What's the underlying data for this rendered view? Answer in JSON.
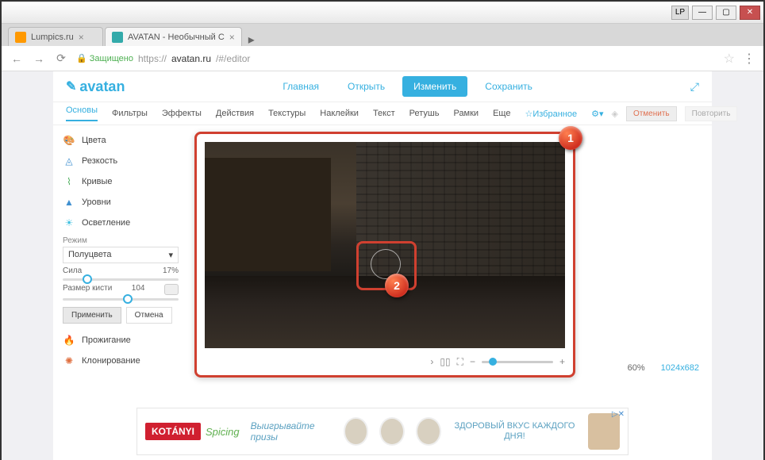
{
  "window": {
    "user_badge": "LP"
  },
  "tabs": [
    {
      "title": "Lumpics.ru"
    },
    {
      "title": "AVATAN - Необычный С"
    }
  ],
  "address": {
    "secure_label": "Защищено",
    "url_prefix": "https://",
    "url_host": "avatan.ru",
    "url_path": "/#/editor"
  },
  "app": {
    "logo": "avatan",
    "nav": {
      "home": "Главная",
      "open": "Открыть",
      "edit": "Изменить",
      "save": "Сохранить"
    },
    "toolbar": {
      "basics": "Основы",
      "filters": "Фильтры",
      "effects": "Эффекты",
      "actions": "Действия",
      "textures": "Текстуры",
      "stickers": "Наклейки",
      "text": "Текст",
      "retouch": "Ретушь",
      "frames": "Рамки",
      "more": "Еще",
      "favorites": "Избранное",
      "undo": "Отменить",
      "redo": "Повторить"
    }
  },
  "sidebar": {
    "colors": "Цвета",
    "sharpness": "Резкость",
    "curves": "Кривые",
    "levels": "Уровни",
    "lighten": "Осветление",
    "mode_label": "Режим",
    "mode_value": "Полуцвета",
    "strength_label": "Сила",
    "strength_value": "17%",
    "brush_label": "Размер кисти",
    "brush_value": "104",
    "apply": "Применить",
    "cancel": "Отмена",
    "burn": "Прожигание",
    "clone": "Клонирование"
  },
  "canvas": {
    "callout1": "1",
    "callout2": "2",
    "zoom_pct": "60%",
    "dimensions": "1024x682",
    "icons": {
      "prev": "›",
      "compare": "▯▯",
      "fullscreen": "⛶",
      "minus": "−",
      "plus": "+"
    }
  },
  "ad": {
    "brand": "KOTÁNYI",
    "tagline": "Spicing",
    "text1": "Выигрывайте призы",
    "text2": "ЗДОРОВЫЙ ВКУС КАЖДОГО ДНЯ!",
    "close": "✕",
    "badge": "▷✕"
  }
}
